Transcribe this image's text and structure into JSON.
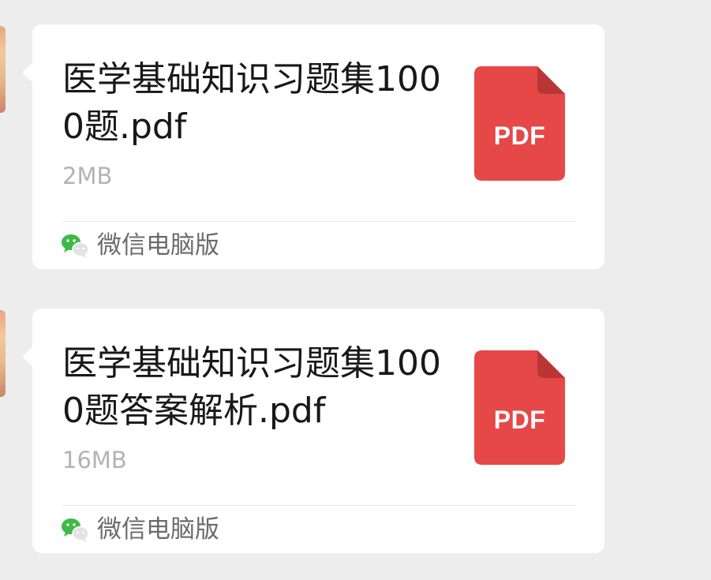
{
  "messages": [
    {
      "file_name": "医学基础知识习题集1000题.pdf",
      "file_size": "2MB",
      "file_type_label": "PDF",
      "source_app": "微信电脑版"
    },
    {
      "file_name": "医学基础知识习题集1000题答案解析.pdf",
      "file_size": "16MB",
      "file_type_label": "PDF",
      "source_app": "微信电脑版"
    }
  ],
  "colors": {
    "background": "#ededed",
    "card": "#ffffff",
    "pdf_red": "#e64747",
    "pdf_fold": "#b93636",
    "file_size_text": "#b3b3b3",
    "source_text": "#6b6b6b",
    "wechat_green": "#3fb945"
  },
  "icons": {
    "file_type": "pdf-file-icon",
    "source_app": "wechat-icon"
  }
}
